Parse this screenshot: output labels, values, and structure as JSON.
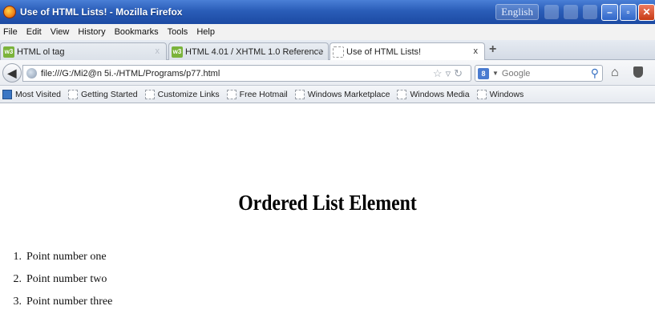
{
  "window": {
    "title": "Use of HTML Lists! - Mozilla Firefox",
    "language": "English",
    "buttons": {
      "minimize": "–",
      "maximize": "▫",
      "close": "✕"
    }
  },
  "menu": [
    "File",
    "Edit",
    "View",
    "History",
    "Bookmarks",
    "Tools",
    "Help"
  ],
  "tabs": [
    {
      "label": "HTML ol tag",
      "favicon": "w3",
      "active": false
    },
    {
      "label": "HTML 4.01 / XHTML 1.0 Reference",
      "favicon": "w3",
      "active": false
    },
    {
      "label": "Use of HTML Lists!",
      "favicon": "blank",
      "active": true
    }
  ],
  "tab_close_glyph": "x",
  "new_tab_glyph": "+",
  "nav": {
    "url": "file:///G:/Mi2@n 5i.-/HTML/Programs/p77.html",
    "search_engine": "8",
    "search_placeholder": "Google"
  },
  "bookmarks": [
    "Most Visited",
    "Getting Started",
    "Customize Links",
    "Free Hotmail",
    "Windows Marketplace",
    "Windows Media",
    "Windows"
  ],
  "page": {
    "heading": "Ordered List Element",
    "items": [
      {
        "num": "1.",
        "text": "Point number one"
      },
      {
        "num": "2.",
        "text": "Point number two"
      },
      {
        "num": "3.",
        "text": "Point number three"
      }
    ]
  },
  "colors": {
    "titlebar": "#2a5db8",
    "favicon_green": "#7bb33b"
  }
}
